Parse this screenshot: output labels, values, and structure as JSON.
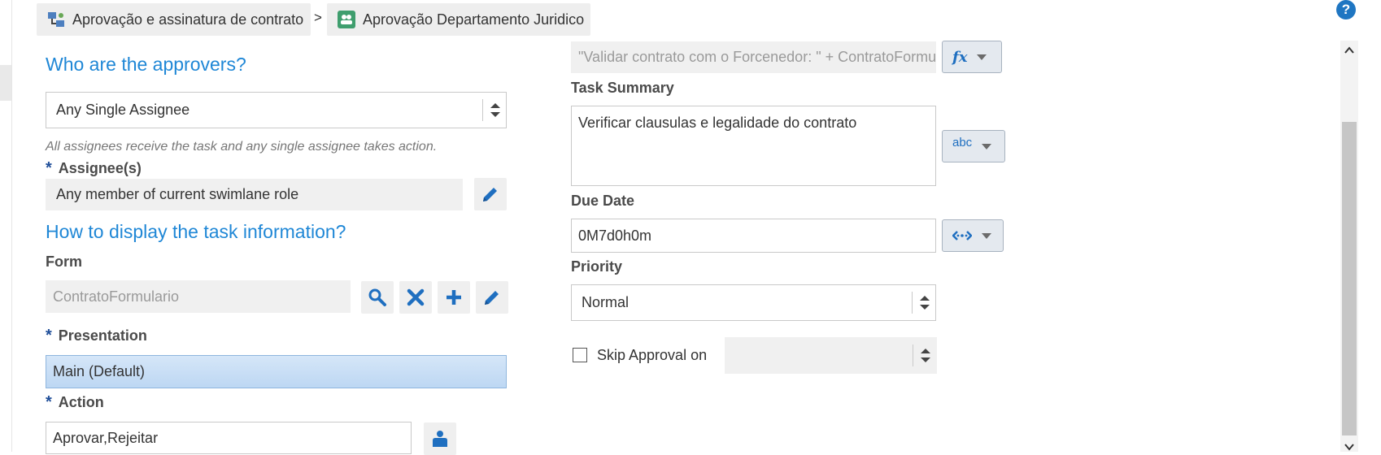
{
  "breadcrumb": {
    "items": [
      {
        "label": "Aprovação e assinatura de contrato",
        "icon": "process-flow-icon"
      },
      {
        "label": "Aprovação Departamento Juridico",
        "icon": "approval-task-icon"
      }
    ],
    "separator": ">"
  },
  "help": {
    "label": "?"
  },
  "left": {
    "approvers_heading": "Who are the approvers?",
    "assignment_type": {
      "value": "Any Single Assignee"
    },
    "assignment_hint": "All assignees receive the task and any single assignee takes action.",
    "assignees": {
      "label": "Assignee(s)",
      "required_mark": "*",
      "value": "Any member of current swimlane role"
    },
    "display_heading": "How to display the task information?",
    "form": {
      "label": "Form",
      "value": "ContratoFormulario"
    },
    "presentation": {
      "label": "Presentation",
      "required_mark": "*",
      "value": "Main (Default)"
    },
    "action": {
      "label": "Action",
      "required_mark": "*",
      "value": "Aprovar,Rejeitar"
    }
  },
  "right": {
    "title_expression": {
      "value": "\"Validar contrato com o Forcenedor: \" + ContratoFormu",
      "mode_icon": "fx"
    },
    "task_summary": {
      "label": "Task Summary",
      "value": "Verificar clausulas e legalidade do contrato",
      "mode_icon": "abc"
    },
    "due_date": {
      "label": "Due Date",
      "value": "0M7d0h0m"
    },
    "priority": {
      "label": "Priority",
      "value": "Normal"
    },
    "skip_approval": {
      "label": "Skip Approval on",
      "checked": false,
      "value": ""
    }
  },
  "colors": {
    "accent": "#1f87d6",
    "help": "#1f76c2",
    "selected": "#c8def5"
  }
}
